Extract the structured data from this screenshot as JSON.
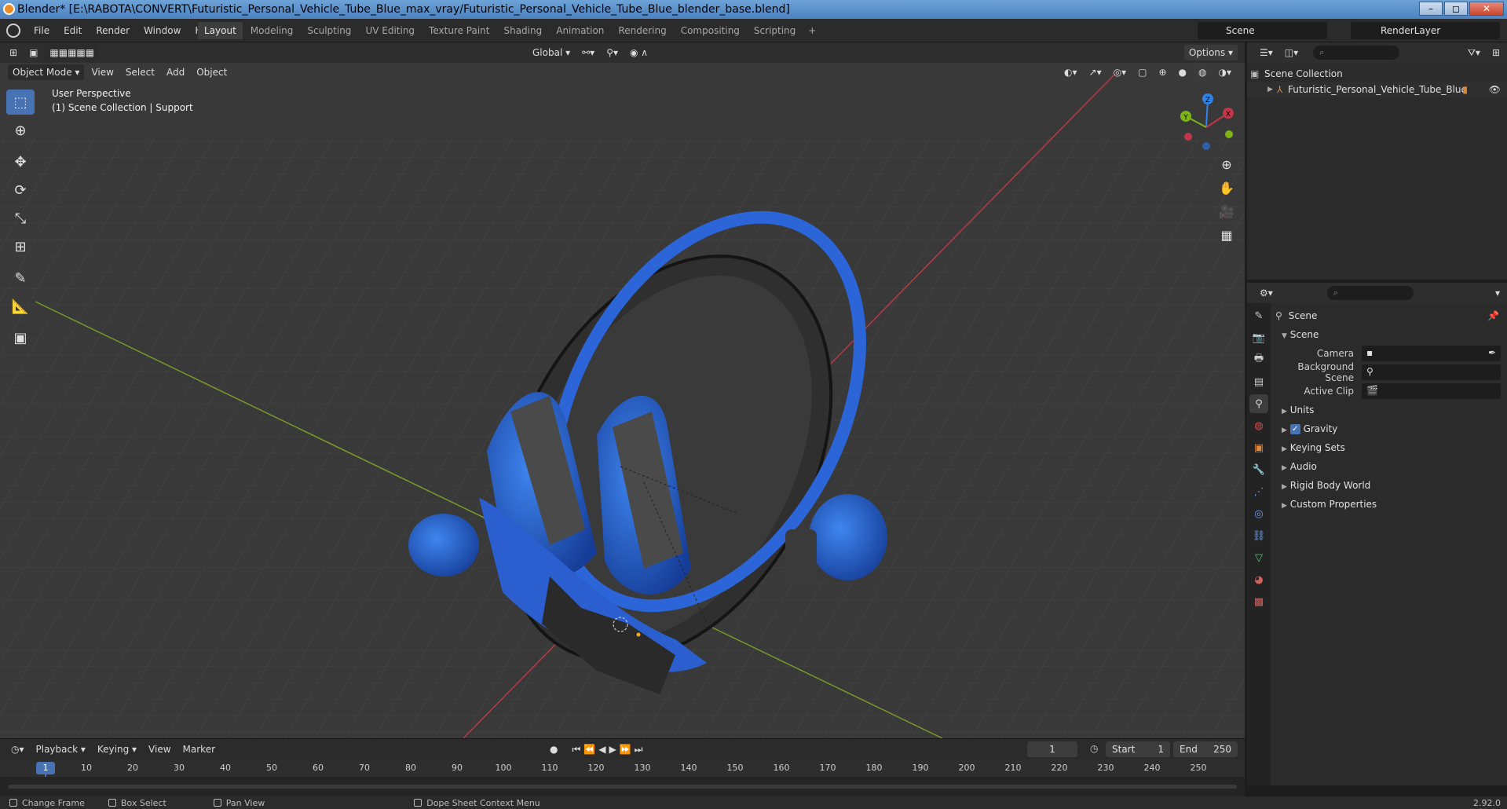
{
  "window": {
    "title": "Blender* [E:\\RABOTA\\CONVERT\\Futuristic_Personal_Vehicle_Tube_Blue_max_vray/Futuristic_Personal_Vehicle_Tube_Blue_blender_base.blend]",
    "min_glyph": "–",
    "max_glyph": "◻",
    "close_glyph": "✕"
  },
  "menu": {
    "file": "File",
    "edit": "Edit",
    "render": "Render",
    "window": "Window",
    "help": "Help"
  },
  "workspaces": [
    "Layout",
    "Modeling",
    "Sculpting",
    "UV Editing",
    "Texture Paint",
    "Shading",
    "Animation",
    "Rendering",
    "Compositing",
    "Scripting"
  ],
  "workspace_plus": "+",
  "scene_name": "Scene",
  "render_layer": "RenderLayer",
  "viewport": {
    "mode": "Object Mode",
    "menu": {
      "view": "View",
      "select": "Select",
      "add": "Add",
      "object": "Object"
    },
    "transform_orientation": "Global",
    "options": "Options",
    "perspective": "User Perspective",
    "collection_info": "(1) Scene Collection | Support",
    "gizmo": {
      "x": "X",
      "y": "Y",
      "z": "Z"
    }
  },
  "outliner": {
    "root": "Scene Collection",
    "item": "Futuristic_Personal_Vehicle_Tube_Blue"
  },
  "properties": {
    "context": "Scene",
    "panel": "Scene",
    "camera_label": "Camera",
    "background_label": "Background Scene",
    "clip_label": "Active Clip",
    "sections": [
      "Units",
      "Gravity",
      "Keying Sets",
      "Audio",
      "Rigid Body World",
      "Custom Properties"
    ],
    "gravity_checked": true
  },
  "timeline": {
    "menu": {
      "playback": "Playback",
      "keying": "Keying",
      "view": "View",
      "marker": "Marker"
    },
    "current_frame": "1",
    "start_label": "Start",
    "start": "1",
    "end_label": "End",
    "end": "250",
    "ticks": [
      "1",
      "10",
      "20",
      "30",
      "40",
      "50",
      "60",
      "70",
      "80",
      "90",
      "100",
      "110",
      "120",
      "130",
      "140",
      "150",
      "160",
      "170",
      "180",
      "190",
      "200",
      "210",
      "220",
      "230",
      "240",
      "250"
    ]
  },
  "status": {
    "change_frame": "Change Frame",
    "box_select": "Box Select",
    "pan_view": "Pan View",
    "context_menu": "Dope Sheet Context Menu",
    "version": "2.92.0"
  },
  "colors": {
    "accent": "#4772b3",
    "vehicle_blue": "#1f5fd0",
    "x_axis": "#c2364a",
    "y_axis": "#7fb418",
    "z_axis": "#2f83e8"
  }
}
